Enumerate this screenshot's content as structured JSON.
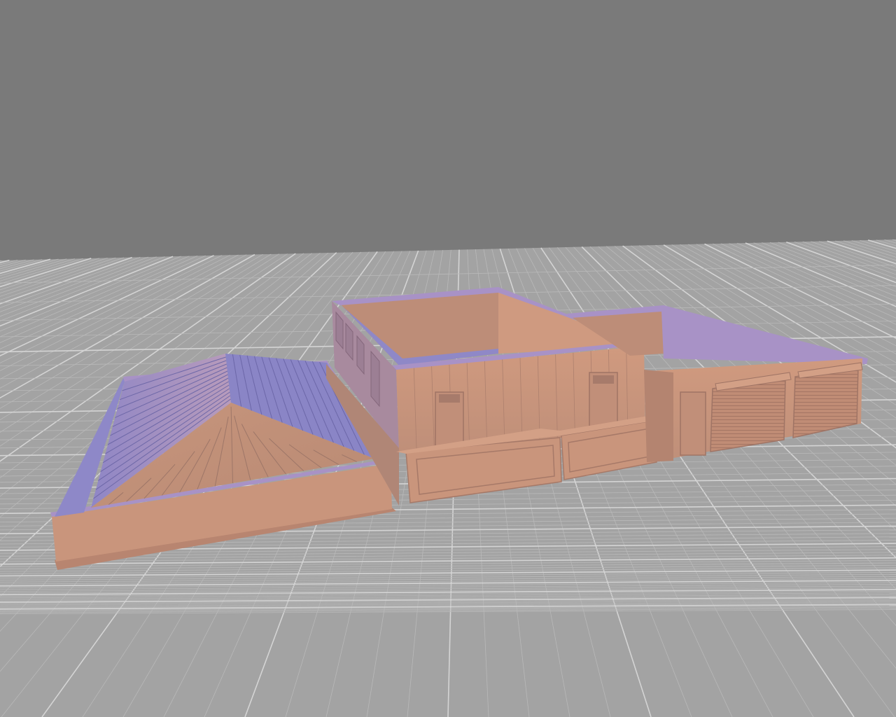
{
  "viewport": {
    "background_color": "#7a7a7a",
    "floor_color": "#a3a3a3",
    "grid_minor_color": "#b9b9b9",
    "grid_major_color": "#d4d4d4"
  },
  "model": {
    "surface_color": "#c8957d",
    "shadow_color": "#8a86c4",
    "parts": [
      "roof-module",
      "main-building-module",
      "garage-module"
    ]
  }
}
